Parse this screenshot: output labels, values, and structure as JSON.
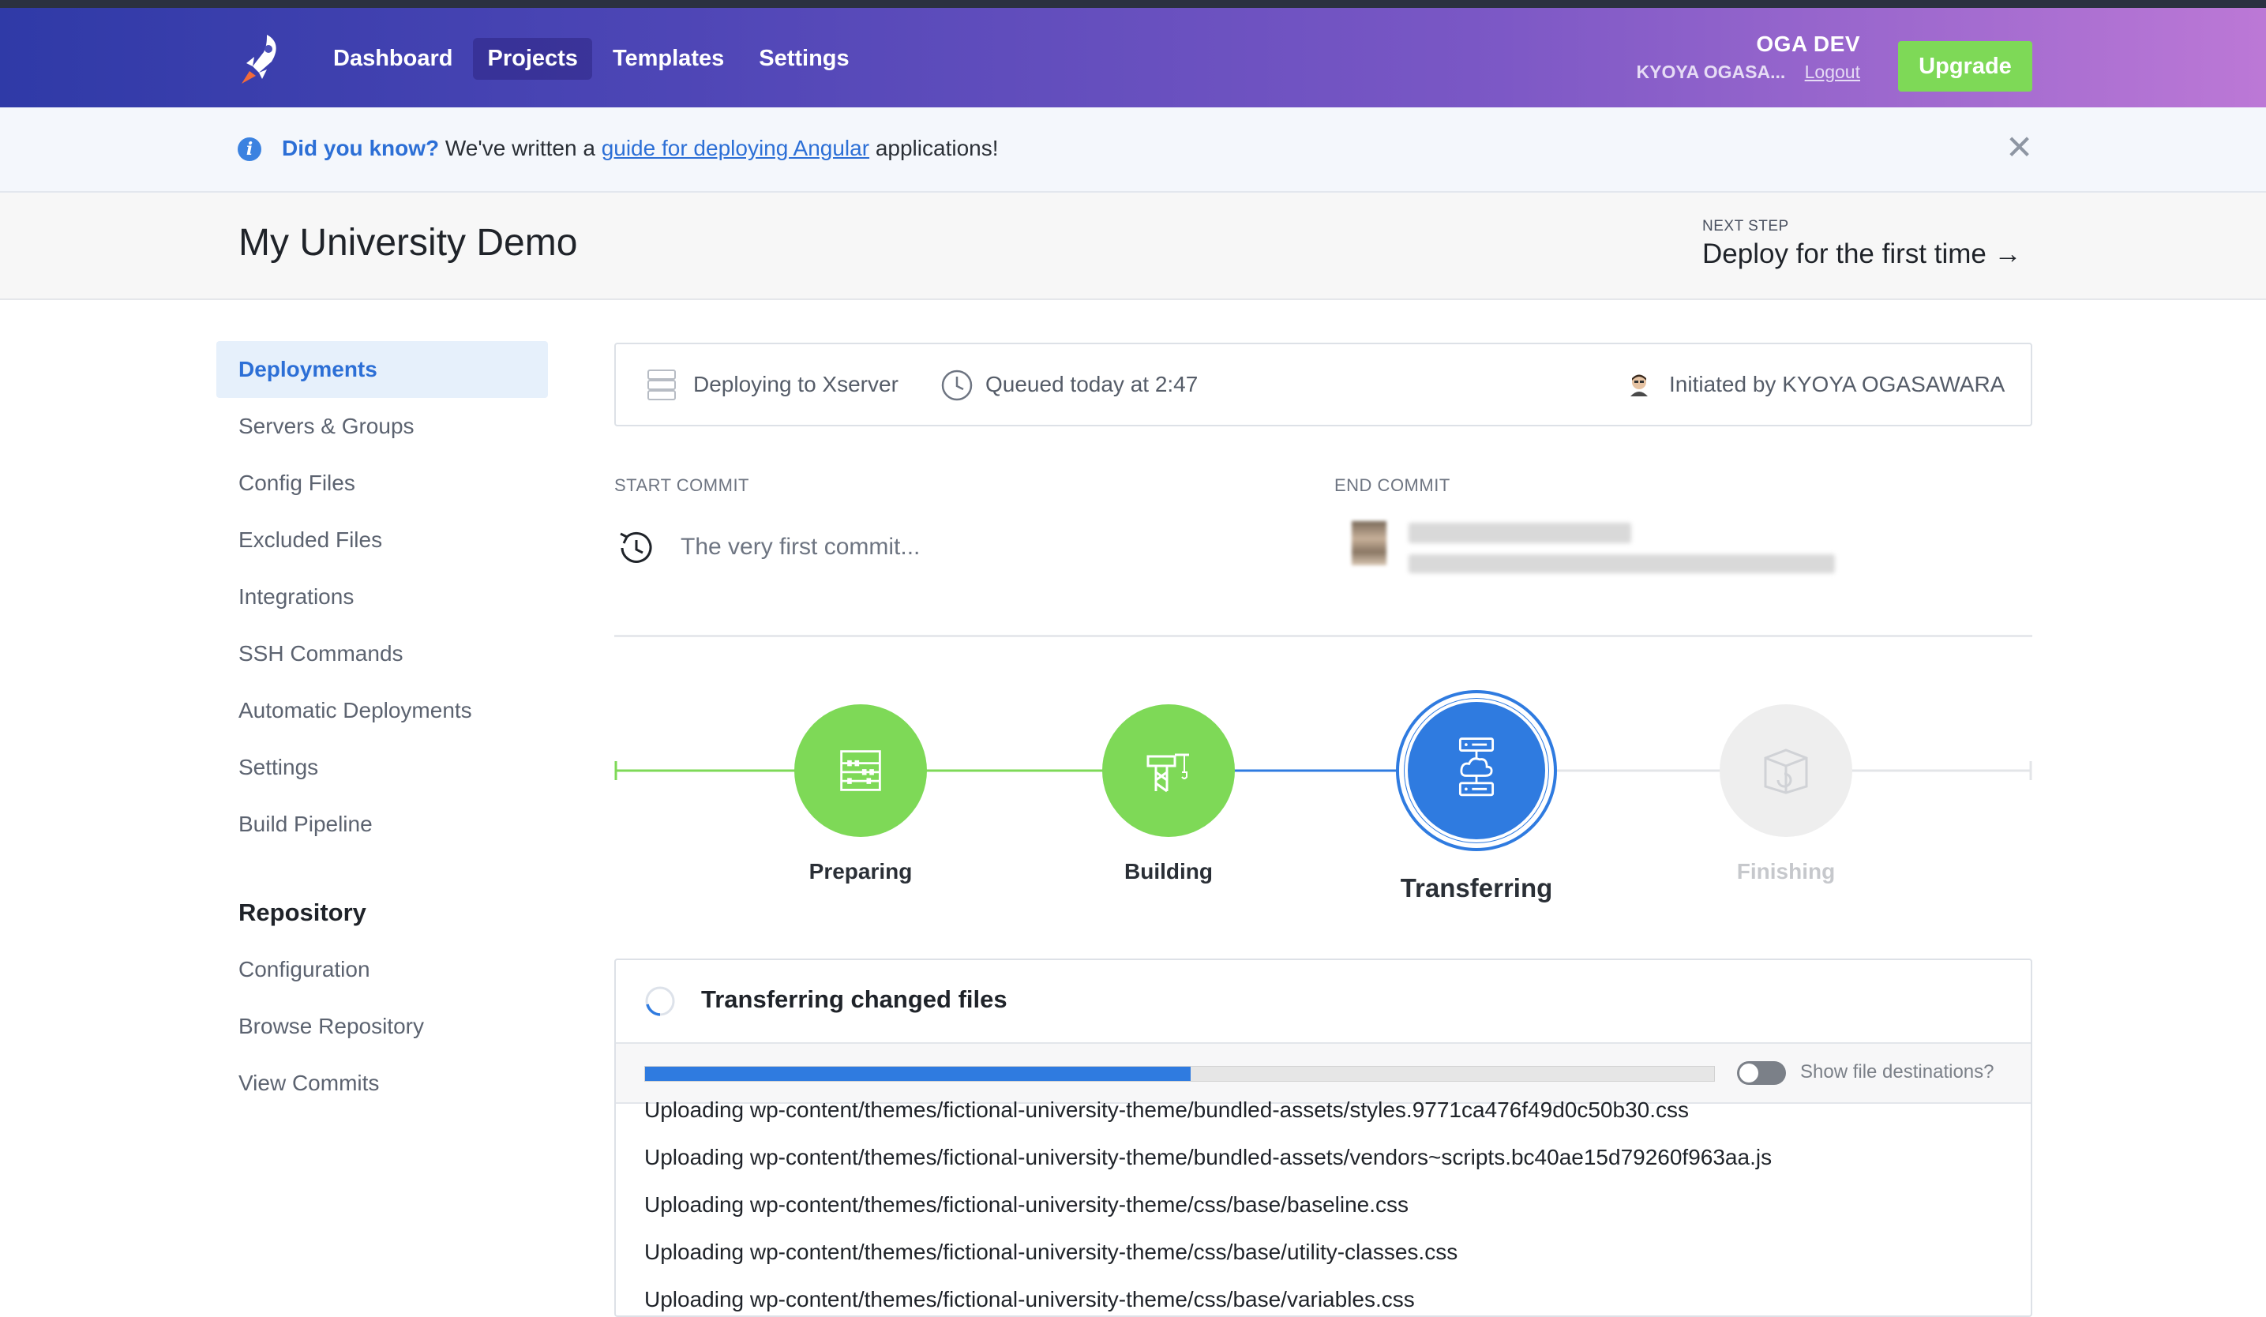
{
  "nav": {
    "logo_icon": "rocket-icon",
    "items": [
      {
        "label": "Dashboard",
        "active": false
      },
      {
        "label": "Projects",
        "active": true
      },
      {
        "label": "Templates",
        "active": false
      },
      {
        "label": "Settings",
        "active": false
      }
    ]
  },
  "account": {
    "org": "OGA DEV",
    "user": "KYOYA OGASA...",
    "logout": "Logout",
    "upgrade": "Upgrade"
  },
  "notice": {
    "icon": "info-icon",
    "lead": "Did you know?",
    "pre": " We've written a ",
    "link": "guide for deploying Angular",
    "post": " applications!",
    "close_icon": "close-icon"
  },
  "page": {
    "title": "My University Demo",
    "next_step_label": "NEXT STEP",
    "next_step": "Deploy for the first time →"
  },
  "sidebar": {
    "items": [
      "Deployments",
      "Servers & Groups",
      "Config Files",
      "Excluded Files",
      "Integrations",
      "SSH Commands",
      "Automatic Deployments",
      "Settings",
      "Build Pipeline"
    ],
    "repo_heading": "Repository",
    "repo_items": [
      "Configuration",
      "Browse Repository",
      "View Commits"
    ]
  },
  "deployment": {
    "target": "Deploying to Xserver",
    "queued": "Queued today at 2:47",
    "initiated": "Initiated by KYOYA OGASAWARA",
    "start_commit_label": "START COMMIT",
    "start_commit": "The very first commit...",
    "end_commit_label": "END COMMIT"
  },
  "pipeline": {
    "steps": [
      {
        "label": "Preparing",
        "state": "done",
        "icon": "abacus-icon"
      },
      {
        "label": "Building",
        "state": "done",
        "icon": "crane-icon"
      },
      {
        "label": "Transferring",
        "state": "active",
        "icon": "server-cloud-icon"
      },
      {
        "label": "Finishing",
        "state": "pending",
        "icon": "box-icon"
      }
    ],
    "colors": {
      "done": "#7ed957",
      "active": "#2f7be0",
      "pending": "#eeeeee"
    }
  },
  "transfer": {
    "title": "Transferring changed files",
    "progress": 0.51,
    "toggle_label": "Show file destinations?",
    "log": [
      "Uploading wp-content/themes/fictional-university-theme/bundled-assets/styles.9771ca476f49d0c50b30.css",
      "Uploading wp-content/themes/fictional-university-theme/bundled-assets/vendors~scripts.bc40ae15d79260f963aa.js",
      "Uploading wp-content/themes/fictional-university-theme/css/base/baseline.css",
      "Uploading wp-content/themes/fictional-university-theme/css/base/utility-classes.css",
      "Uploading wp-content/themes/fictional-university-theme/css/base/variables.css"
    ]
  }
}
